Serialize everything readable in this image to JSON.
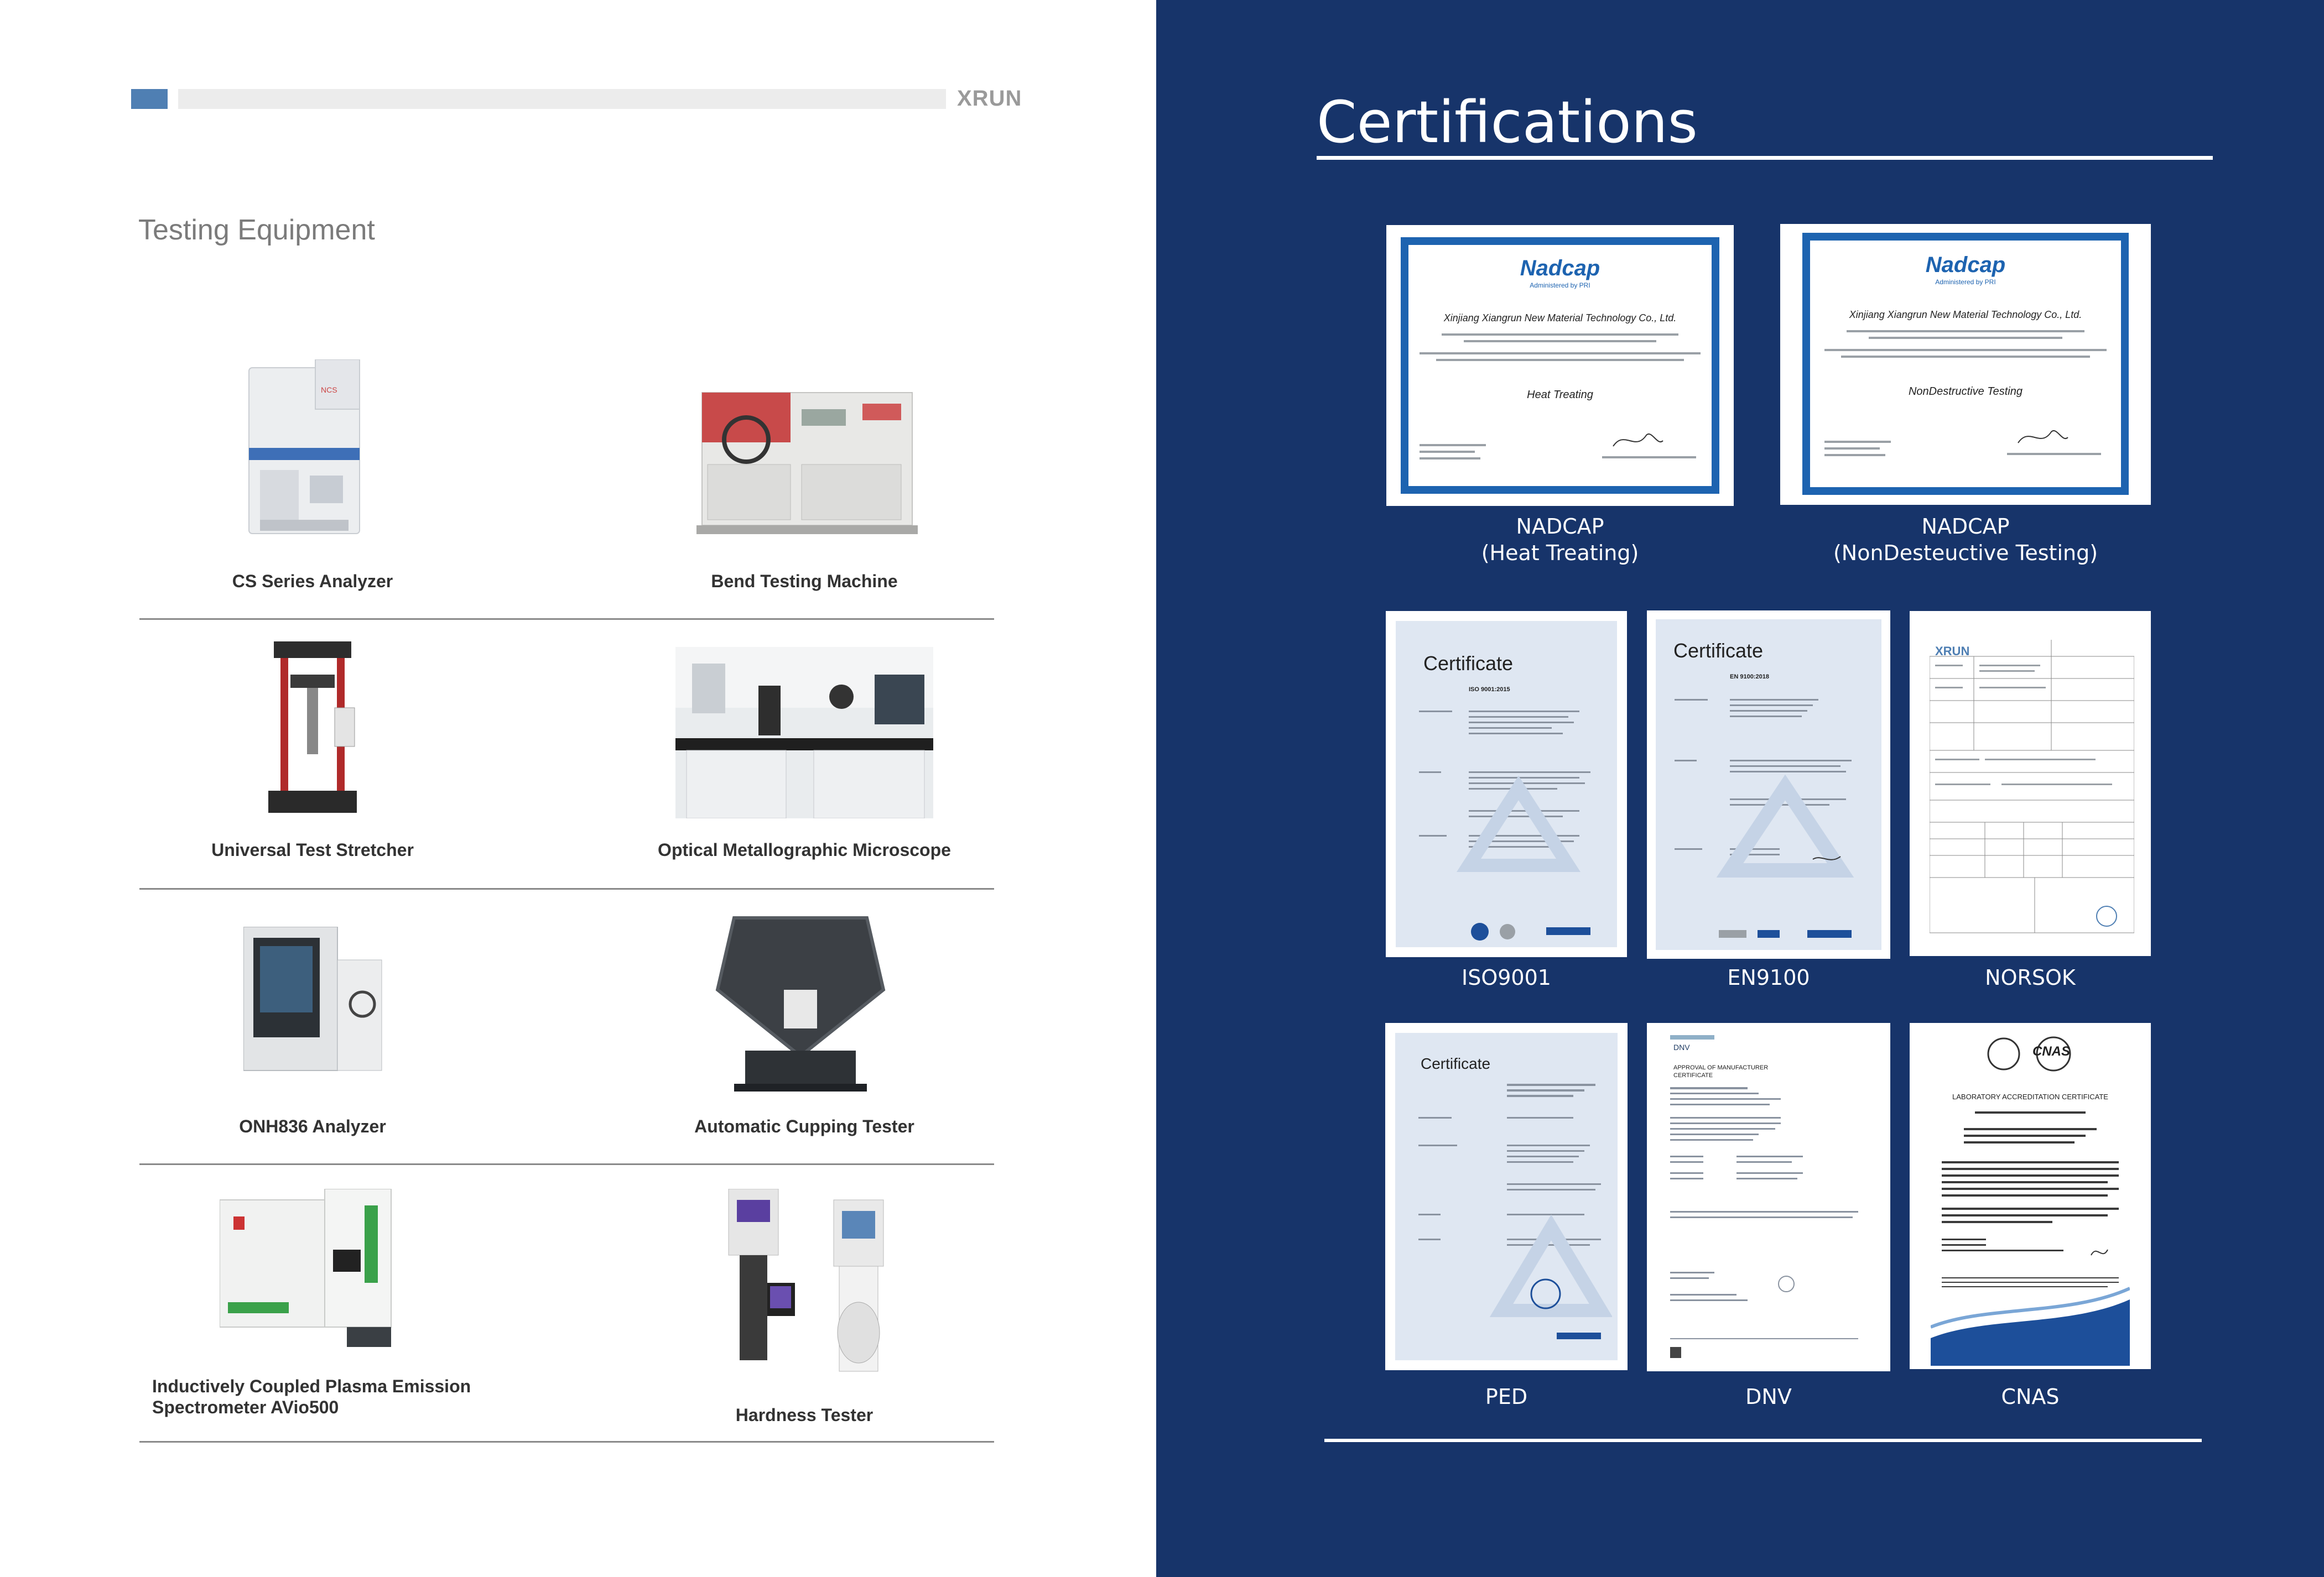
{
  "header": {
    "brand": "XRUN"
  },
  "left": {
    "section_title": "Testing Equipment",
    "equipment": [
      {
        "name": "CS Series Analyzer",
        "icon": "cs-analyzer-photo"
      },
      {
        "name": "Bend Testing Machine",
        "icon": "bend-machine-photo"
      },
      {
        "name": "Universal Test Stretcher",
        "icon": "test-stretcher-photo"
      },
      {
        "name": "Optical Metallographic Microscope",
        "icon": "microscope-lab-photo"
      },
      {
        "name": "ONH836 Analyzer",
        "icon": "onh-analyzer-photo"
      },
      {
        "name": "Automatic Cupping Tester",
        "icon": "cupping-tester-photo"
      },
      {
        "name_line1": "Inductively Coupled Plasma Emission",
        "name_line2": "Spectrometer AVio500",
        "icon": "icp-spectrometer-photo"
      },
      {
        "name": "Hardness Tester",
        "icon": "hardness-tester-photo"
      }
    ]
  },
  "right": {
    "title": "Certifications",
    "certs": [
      {
        "line1": "NADCAP",
        "line2": "(Heat  Treating)",
        "doc_logo": "Nadcap",
        "doc_sub": "Administered by PRI",
        "doc_company": "Xinjiang Xiangrun New Material Technology Co., Ltd.",
        "doc_scope": "Heat Treating"
      },
      {
        "line1": "NADCAP",
        "line2": "(NonDesteuctive Testing)",
        "doc_logo": "Nadcap",
        "doc_sub": "Administered by PRI",
        "doc_company": "Xinjiang Xiangrun New Material Technology Co., Ltd.",
        "doc_scope": "NonDestructive Testing"
      },
      {
        "line1": "ISO9001",
        "doc_heading": "Certificate",
        "doc_standard": "ISO 9001:2015"
      },
      {
        "line1": "EN9100",
        "doc_heading": "Certificate",
        "doc_standard": "EN 9100:2018"
      },
      {
        "line1": "NORSOK",
        "doc_heading": "XRUN"
      },
      {
        "line1": "PED",
        "doc_heading": "Certificate"
      },
      {
        "line1": "DNV",
        "doc_heading": "DNV",
        "doc_sub": "APPROVAL OF MANUFACTURER CERTIFICATE"
      },
      {
        "line1": "CNAS",
        "doc_heading": "CNAS",
        "doc_sub": "LABORATORY ACCREDITATION CERTIFICATE"
      }
    ]
  },
  "colors": {
    "navy": "#17346a",
    "accent_blue": "#4f7fb3",
    "nadcap_blue": "#1d63b0"
  }
}
